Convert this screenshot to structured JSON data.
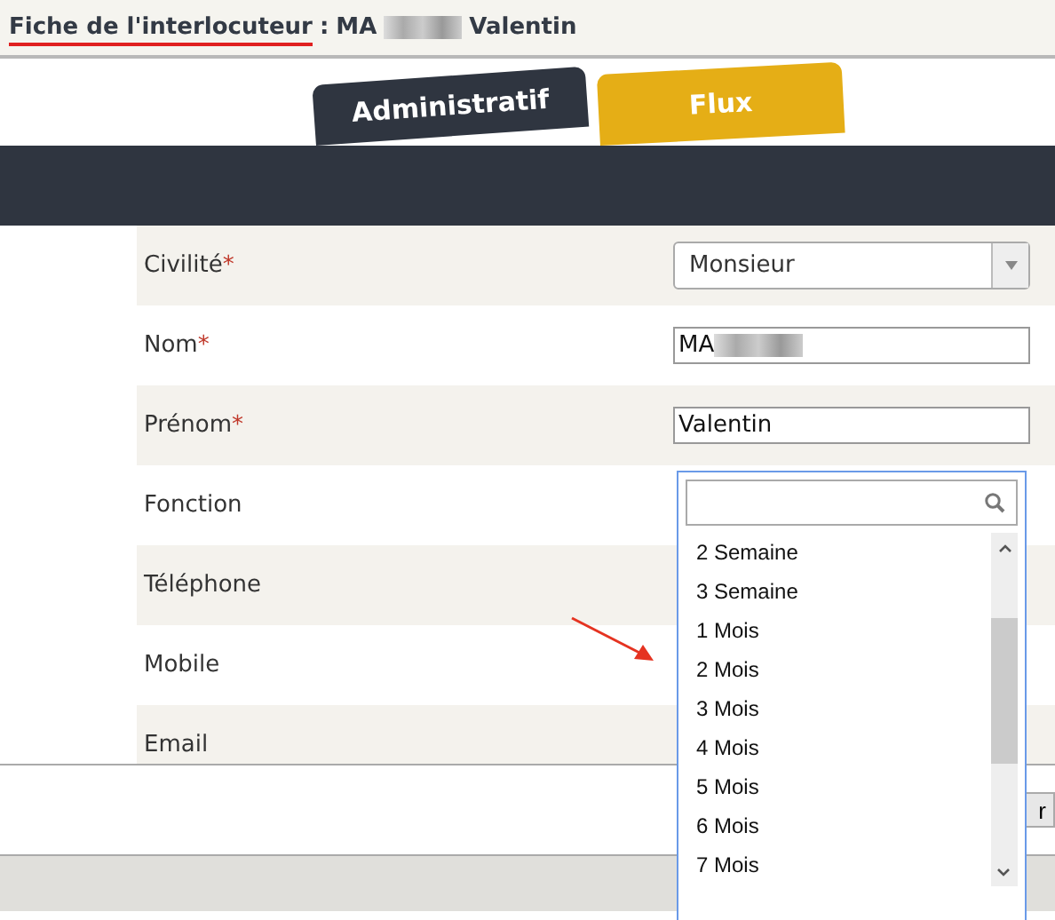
{
  "header": {
    "title": "Fiche de l'interlocuteur",
    "separator": ":",
    "name_visible": "MA",
    "first_name": "Valentin"
  },
  "tabs": [
    {
      "label": "Administratif",
      "selected": true
    },
    {
      "label": "Flux",
      "selected": false
    }
  ],
  "form": {
    "rows": [
      {
        "label": "Civilité",
        "required_mark": "*",
        "kind": "select",
        "value": "Monsieur"
      },
      {
        "label": "Nom",
        "required_mark": "*",
        "kind": "redacted",
        "value": "MA"
      },
      {
        "label": "Prénom",
        "required_mark": "*",
        "kind": "text",
        "value": "Valentin"
      },
      {
        "label": "Fonction",
        "kind": "hidden"
      },
      {
        "label": "Téléphone",
        "kind": "hidden"
      },
      {
        "label": "Mobile",
        "kind": "hidden"
      },
      {
        "label": "Email",
        "kind": "hidden"
      }
    ]
  },
  "button": {
    "label": "r"
  },
  "dropdown": {
    "options": [
      "2 Semaine",
      "3 Semaine",
      "1 Mois",
      "2 Mois",
      "3 Mois",
      "4 Mois",
      "5 Mois",
      "6 Mois",
      "7 Mois"
    ]
  }
}
